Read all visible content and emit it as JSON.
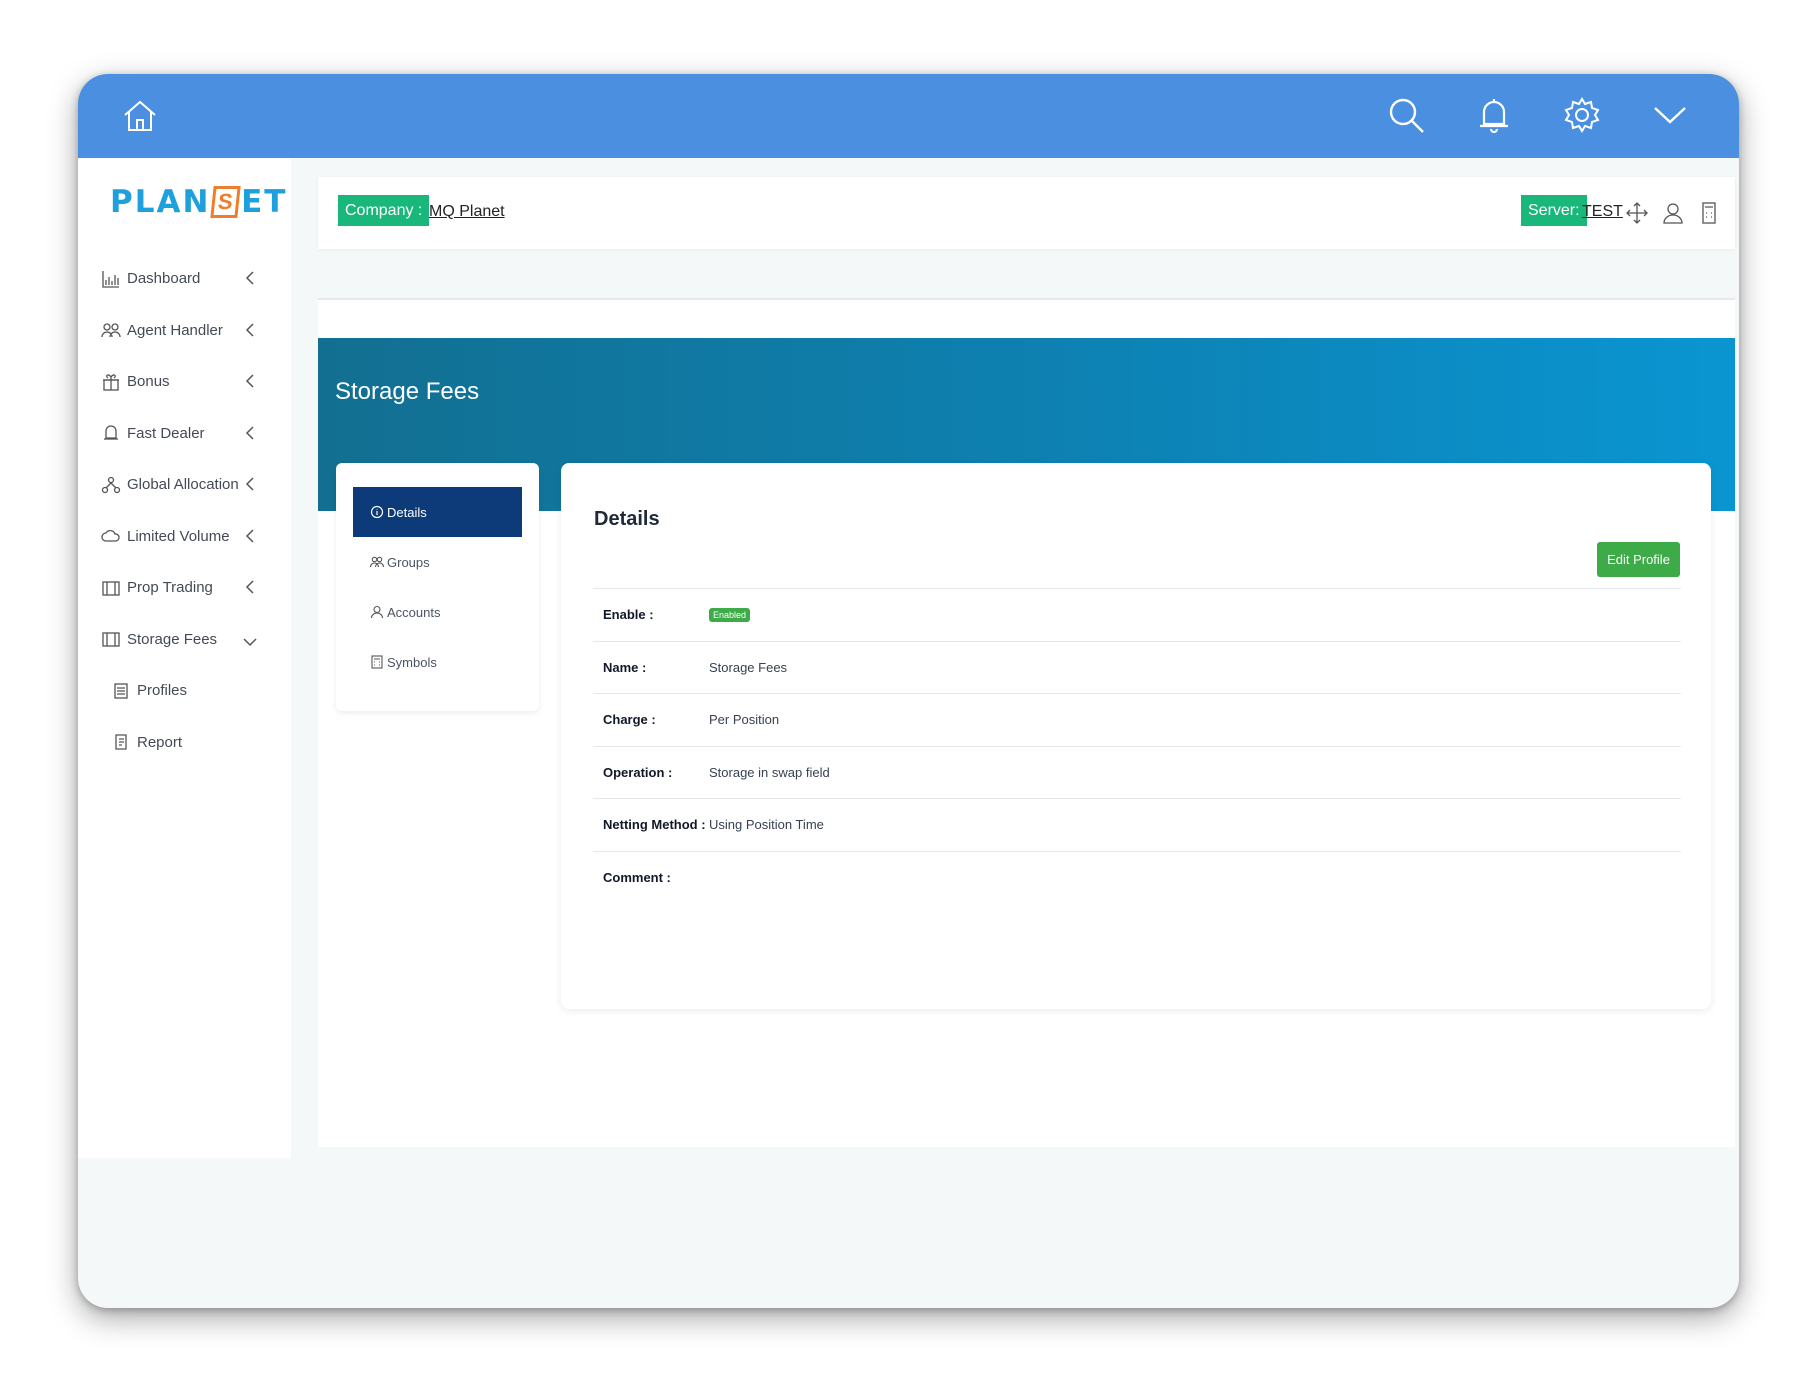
{
  "brand": {
    "logo_left": "PLAN",
    "logo_box": "S",
    "logo_right": "ET"
  },
  "colors": {
    "topbar": "#4a8fe0",
    "brand_blue": "#1da0db",
    "brand_orange": "#f07d2b",
    "accent_green": "#19b87a",
    "hero": "#0d84b7",
    "active_tab": "#0d3a78",
    "button_green": "#3dab47"
  },
  "topbar": {
    "icons": [
      "home-icon",
      "search-icon",
      "bell-icon",
      "gear-icon",
      "chevron-down-icon"
    ]
  },
  "sidebar": {
    "items": [
      {
        "label": "Dashboard",
        "icon": "chart-icon"
      },
      {
        "label": "Agent Handler",
        "icon": "users-icon"
      },
      {
        "label": "Bonus",
        "icon": "gift-icon"
      },
      {
        "label": "Fast Dealer",
        "icon": "bell-icon"
      },
      {
        "label": "Global Allocation",
        "icon": "network-icon"
      },
      {
        "label": "Limited Volume",
        "icon": "cloud-icon"
      },
      {
        "label": "Prop Trading",
        "icon": "columns-icon"
      },
      {
        "label": "Storage Fees",
        "icon": "columns-icon"
      }
    ],
    "subitems": [
      {
        "label": "Profiles",
        "icon": "list-icon"
      },
      {
        "label": "Report",
        "icon": "report-icon"
      }
    ]
  },
  "company_bar": {
    "company_tag": "Company :",
    "company_name": "MQ Planet",
    "server_tag": "Server:",
    "server_name": "TEST"
  },
  "page": {
    "title": "Storage Fees"
  },
  "tabs": [
    {
      "label": "Details",
      "icon": "info-icon"
    },
    {
      "label": "Groups",
      "icon": "users-icon"
    },
    {
      "label": "Accounts",
      "icon": "user-icon"
    },
    {
      "label": "Symbols",
      "icon": "calculator-icon"
    }
  ],
  "details": {
    "title": "Details",
    "edit_label": "Edit Profile",
    "enable_label": "Enable :",
    "enable_badge": "Enabled",
    "rows": [
      {
        "label": "Name :",
        "value": "Storage Fees"
      },
      {
        "label": "Charge :",
        "value": "Per Position"
      },
      {
        "label": "Operation :",
        "value": "Storage in swap field"
      },
      {
        "label": "Netting Method :",
        "value": "Using Position Time"
      },
      {
        "label": "Comment :",
        "value": ""
      }
    ]
  }
}
